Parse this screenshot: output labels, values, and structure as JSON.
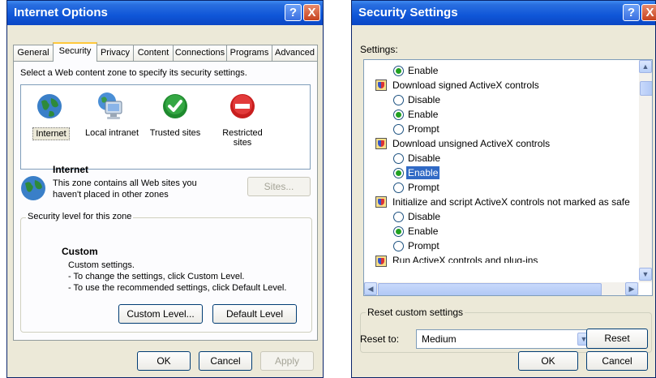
{
  "internet_options": {
    "title": "Internet Options",
    "help_label": "?",
    "close_label": "X",
    "tabs": [
      "General",
      "Security",
      "Privacy",
      "Content",
      "Connections",
      "Programs",
      "Advanced"
    ],
    "active_tab": "Security",
    "instruction": "Select a Web content zone to specify its security settings.",
    "zones": [
      {
        "label": "Internet",
        "icon": "globe-icon",
        "selected": true
      },
      {
        "label": "Local intranet",
        "icon": "monitor-globe-icon"
      },
      {
        "label": "Trusted sites",
        "icon": "green-check-icon"
      },
      {
        "label": "Restricted sites",
        "icon": "red-no-entry-icon"
      }
    ],
    "zone_heading": "Internet",
    "zone_desc_1": "This zone contains all Web sites you",
    "zone_desc_2": "haven't placed in other zones",
    "sites_label": "Sites...",
    "group_label": "Security level for this zone",
    "level_title": "Custom",
    "level_line_1": "Custom settings.",
    "level_line_2": "- To change the settings, click Custom Level.",
    "level_line_3": "- To use the recommended settings, click Default Level.",
    "custom_level_label": "Custom Level...",
    "default_level_label": "Default Level",
    "ok_label": "OK",
    "cancel_label": "Cancel",
    "apply_label": "Apply"
  },
  "security_settings": {
    "title": "Security Settings",
    "help_label": "?",
    "close_label": "X",
    "settings_label": "Settings:",
    "items": [
      {
        "type": "option",
        "label": "Enable",
        "checked": true
      },
      {
        "type": "header",
        "label": "Download signed ActiveX controls"
      },
      {
        "type": "option",
        "label": "Disable",
        "checked": false
      },
      {
        "type": "option",
        "label": "Enable",
        "checked": true
      },
      {
        "type": "option",
        "label": "Prompt",
        "checked": false
      },
      {
        "type": "header",
        "label": "Download unsigned ActiveX controls"
      },
      {
        "type": "option",
        "label": "Disable",
        "checked": false
      },
      {
        "type": "option",
        "label": "Enable",
        "checked": true,
        "highlighted": true
      },
      {
        "type": "option",
        "label": "Prompt",
        "checked": false
      },
      {
        "type": "header",
        "label": "Initialize and script ActiveX controls not marked as safe"
      },
      {
        "type": "option",
        "label": "Disable",
        "checked": false
      },
      {
        "type": "option",
        "label": "Enable",
        "checked": true
      },
      {
        "type": "option",
        "label": "Prompt",
        "checked": false
      },
      {
        "type": "header",
        "label": "Run ActiveX controls and plug-ins"
      }
    ],
    "reset_group_label": "Reset custom settings",
    "reset_to_label": "Reset to:",
    "reset_value": "Medium",
    "reset_label": "Reset",
    "ok_label": "OK",
    "cancel_label": "Cancel",
    "colors": {
      "title_blue": "#0b4fd6",
      "highlight": "#316ac5",
      "radio_dot": "#21a121"
    }
  }
}
